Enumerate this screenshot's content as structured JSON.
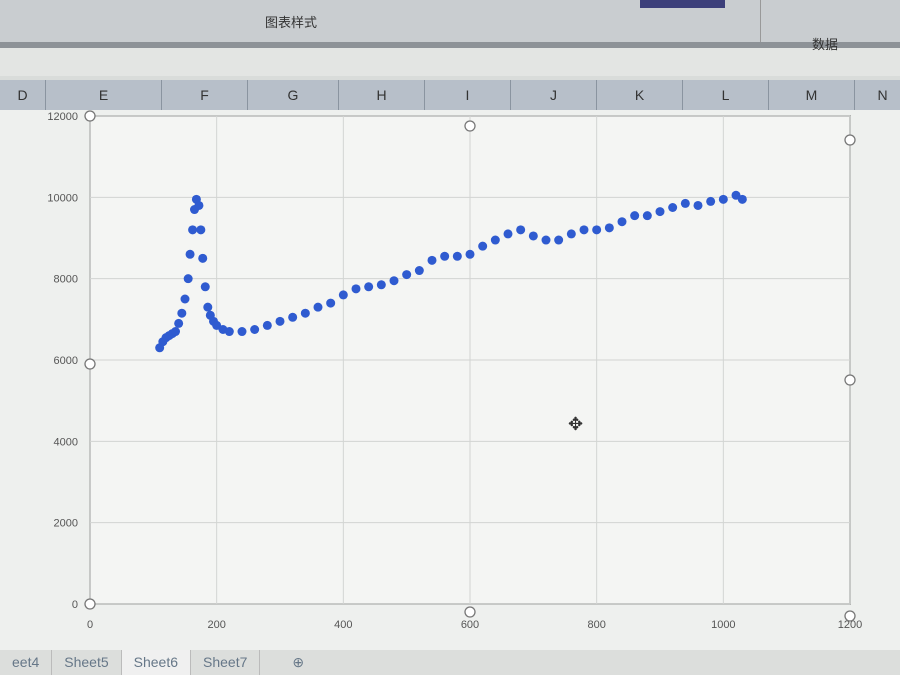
{
  "ribbon": {
    "chart_styles": "图表样式",
    "data": "数据"
  },
  "columns": [
    "D",
    "E",
    "F",
    "G",
    "H",
    "I",
    "J",
    "K",
    "L",
    "M",
    "N"
  ],
  "sheet_tabs": [
    "eet4",
    "Sheet5",
    "Sheet6",
    "Sheet7"
  ],
  "add_sheet_icon": "plus-circle-icon",
  "cursor_icon": "move-cursor-icon",
  "chart_data": {
    "type": "scatter",
    "title": "",
    "xlabel": "",
    "ylabel": "",
    "xlim": [
      0,
      1200
    ],
    "ylim": [
      0,
      12000
    ],
    "xticks": [
      "0",
      "200",
      "400",
      "600",
      "800",
      "1000",
      "1200"
    ],
    "yticks": [
      "0",
      "2000",
      "4000",
      "6000",
      "8000",
      "10000",
      "12000"
    ],
    "grid": true,
    "marker_color": "#2f5bd0",
    "points": [
      [
        110,
        6300
      ],
      [
        115,
        6450
      ],
      [
        120,
        6550
      ],
      [
        125,
        6600
      ],
      [
        130,
        6650
      ],
      [
        135,
        6700
      ],
      [
        140,
        6900
      ],
      [
        145,
        7150
      ],
      [
        150,
        7500
      ],
      [
        155,
        8000
      ],
      [
        158,
        8600
      ],
      [
        162,
        9200
      ],
      [
        165,
        9700
      ],
      [
        168,
        9950
      ],
      [
        172,
        9800
      ],
      [
        175,
        9200
      ],
      [
        178,
        8500
      ],
      [
        182,
        7800
      ],
      [
        186,
        7300
      ],
      [
        190,
        7100
      ],
      [
        195,
        6950
      ],
      [
        200,
        6850
      ],
      [
        210,
        6750
      ],
      [
        220,
        6700
      ],
      [
        240,
        6700
      ],
      [
        260,
        6750
      ],
      [
        280,
        6850
      ],
      [
        300,
        6950
      ],
      [
        320,
        7050
      ],
      [
        340,
        7150
      ],
      [
        360,
        7300
      ],
      [
        380,
        7400
      ],
      [
        400,
        7600
      ],
      [
        420,
        7750
      ],
      [
        440,
        7800
      ],
      [
        460,
        7850
      ],
      [
        480,
        7950
      ],
      [
        500,
        8100
      ],
      [
        520,
        8200
      ],
      [
        540,
        8450
      ],
      [
        560,
        8550
      ],
      [
        580,
        8550
      ],
      [
        600,
        8600
      ],
      [
        620,
        8800
      ],
      [
        640,
        8950
      ],
      [
        660,
        9100
      ],
      [
        680,
        9200
      ],
      [
        700,
        9050
      ],
      [
        720,
        8950
      ],
      [
        740,
        8950
      ],
      [
        760,
        9100
      ],
      [
        780,
        9200
      ],
      [
        800,
        9200
      ],
      [
        820,
        9250
      ],
      [
        840,
        9400
      ],
      [
        860,
        9550
      ],
      [
        880,
        9550
      ],
      [
        900,
        9650
      ],
      [
        920,
        9750
      ],
      [
        940,
        9850
      ],
      [
        960,
        9800
      ],
      [
        980,
        9900
      ],
      [
        1000,
        9950
      ],
      [
        1020,
        10050
      ],
      [
        1030,
        9950
      ]
    ]
  }
}
